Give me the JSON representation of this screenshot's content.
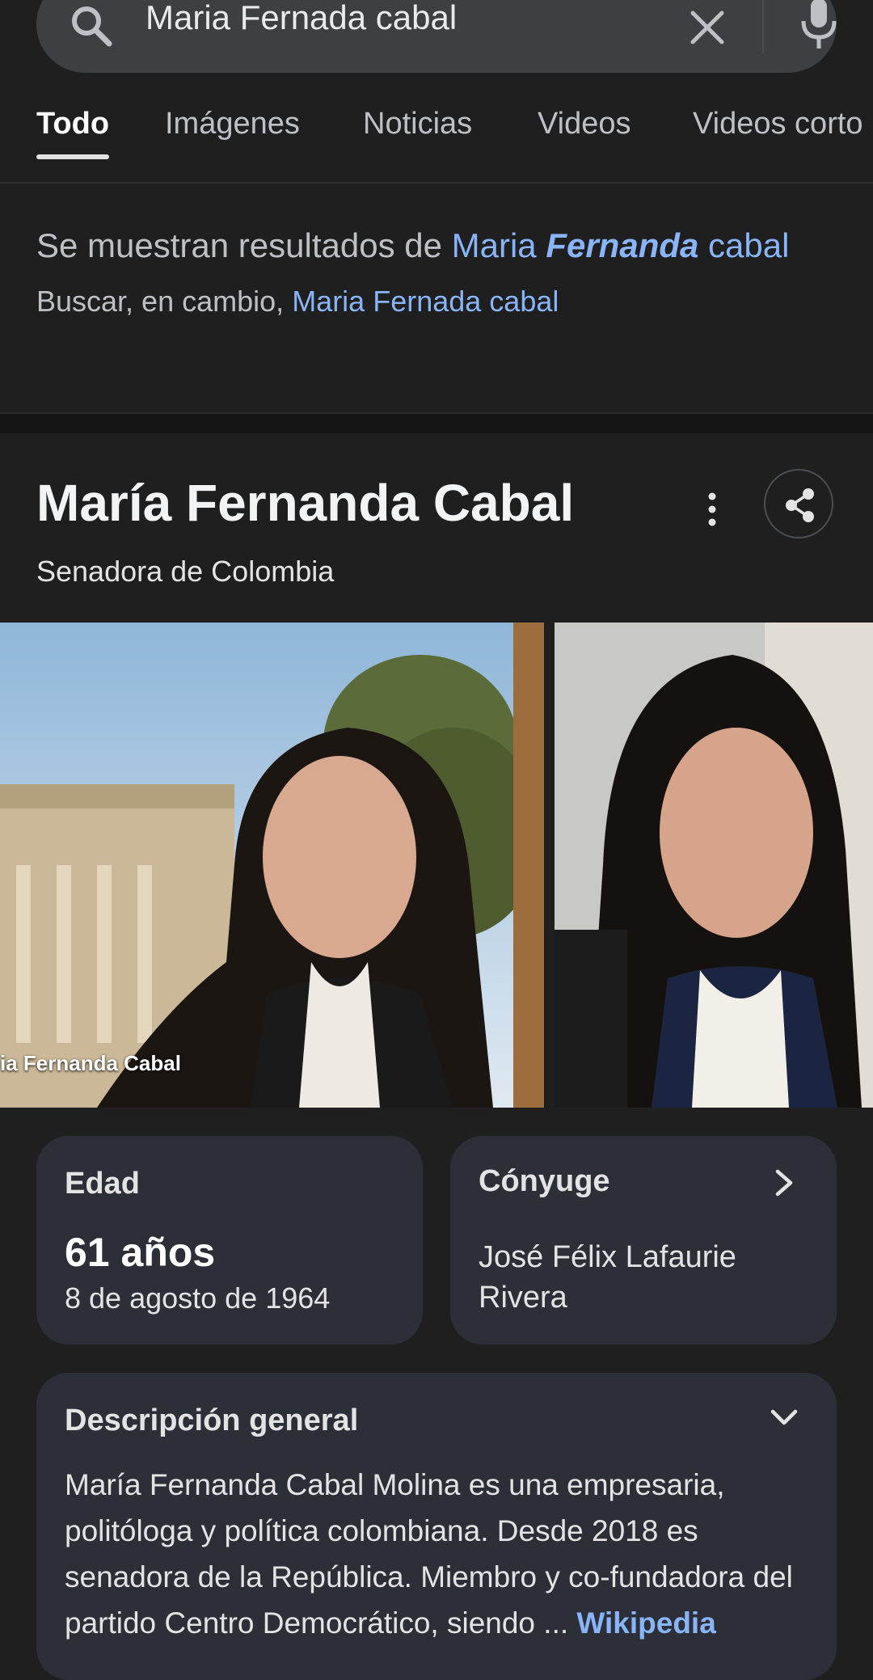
{
  "search": {
    "query": "Maria Fernada cabal"
  },
  "tabs": [
    {
      "label": "Todo",
      "active": true
    },
    {
      "label": "Imágenes"
    },
    {
      "label": "Noticias"
    },
    {
      "label": "Videos"
    },
    {
      "label": "Videos corto"
    }
  ],
  "spelling": {
    "prefix": "Se muestran resultados de",
    "corrected_part1": "Maria",
    "corrected_bold": "Fernanda",
    "corrected_part2": "cabal",
    "alt_prefix": "Buscar, en cambio,",
    "alt_query": "Maria Fernada cabal"
  },
  "knowledge_panel": {
    "title": "María Fernanda Cabal",
    "subtitle": "Senadora de Colombia",
    "photo_caption": "ia Fernanda Cabal",
    "age": {
      "label": "Edad",
      "value": "61 años",
      "birthdate": "8 de agosto de 1964"
    },
    "spouse": {
      "label": "Cónyuge",
      "value": "José Félix Lafaurie Rivera"
    },
    "overview": {
      "label": "Descripción general",
      "text": "María Fernanda Cabal Molina es una empresaria, politóloga y política colombiana. Desde 2018 es senadora de la República. Miembro y co-fundadora del partido Centro Democrático, siendo ...",
      "source": "Wikipedia"
    }
  },
  "colors": {
    "background": "#1f1f1f",
    "link": "#8ab4f8",
    "card": "#2c2f38",
    "searchbar": "#3c4043"
  },
  "icons": [
    "search-icon",
    "clear-icon",
    "mic-icon",
    "more-vert-icon",
    "share-icon",
    "chevron-right-icon",
    "chevron-down-icon"
  ]
}
